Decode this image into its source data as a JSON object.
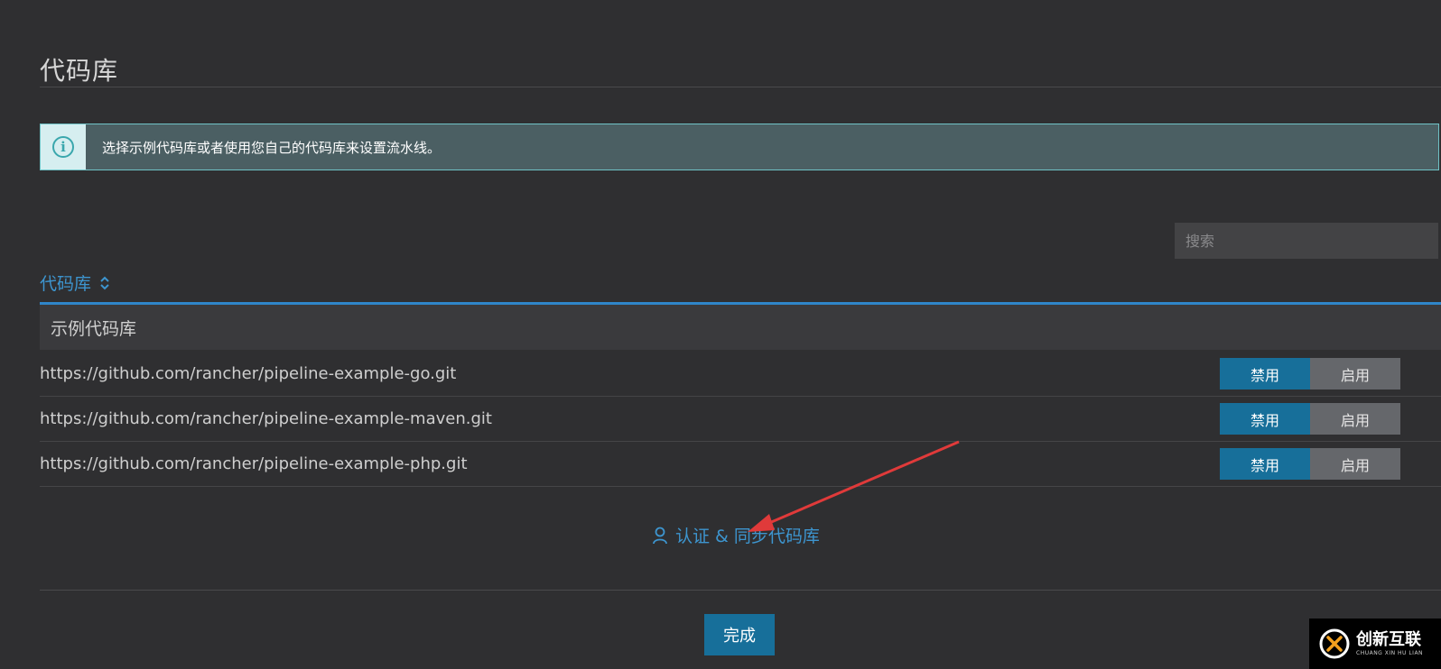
{
  "page": {
    "title": "代码库"
  },
  "banner": {
    "icon": "info-icon",
    "icon_glyph": "i",
    "text": "选择示例代码库或者使用您自己的代码库来设置流水线。"
  },
  "search": {
    "placeholder": "搜索",
    "value": ""
  },
  "table": {
    "column_header": "代码库",
    "sort_icon": "sort-updown-icon",
    "group_label": "示例代码库",
    "rows": [
      {
        "url": "https://github.com/rancher/pipeline-example-go.git",
        "disable_label": "禁用",
        "enable_label": "启用",
        "state": "disabled"
      },
      {
        "url": "https://github.com/rancher/pipeline-example-maven.git",
        "disable_label": "禁用",
        "enable_label": "启用",
        "state": "disabled"
      },
      {
        "url": "https://github.com/rancher/pipeline-example-php.git",
        "disable_label": "禁用",
        "enable_label": "启用",
        "state": "disabled"
      }
    ]
  },
  "sync_link": {
    "icon": "user-icon",
    "label": "认证 & 同步代码库"
  },
  "footer": {
    "done_label": "完成"
  },
  "watermark": {
    "main": "创新互联",
    "sub": "CHUANG XIN HU LIAN"
  },
  "colors": {
    "background": "#2f2f31",
    "accent_blue": "#3d95cf",
    "primary_button": "#176f9a",
    "secondary_button": "#65676b",
    "banner_bg": "#4b5f63",
    "banner_border": "#6fc3c7",
    "annotation_arrow": "#e03a3a"
  }
}
